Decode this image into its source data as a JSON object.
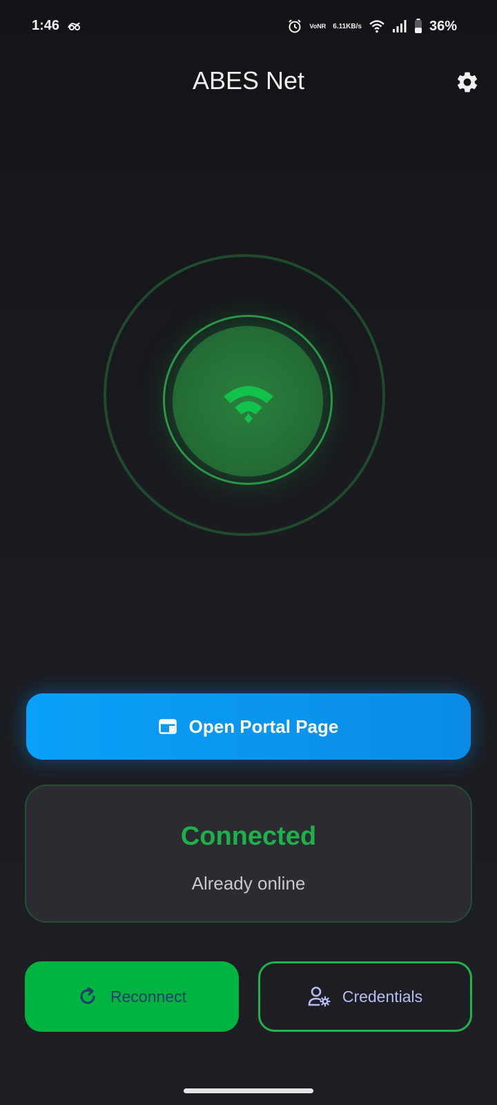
{
  "status_bar": {
    "time": "1:46",
    "volte_top": "Vo",
    "volte_bottom": "NR",
    "speed_value": "6.11",
    "speed_unit": "KB/s",
    "battery_percent": "36%",
    "icons": [
      "alarm-icon",
      "volte-icon",
      "wifi-icon",
      "signal-icon",
      "battery-icon"
    ]
  },
  "header": {
    "title": "ABES Net",
    "settings_icon": "gear-icon"
  },
  "connection_graphic": {
    "icon": "wifi-icon",
    "accent_color": "#20b04a"
  },
  "portal_button": {
    "label": "Open Portal Page",
    "icon": "web-page-icon",
    "color": "#0a97f0"
  },
  "status_card": {
    "title": "Connected",
    "subtitle": "Already online",
    "title_color": "#20b04a"
  },
  "actions": {
    "reconnect_label": "Reconnect",
    "reconnect_icon": "refresh-icon",
    "credentials_label": "Credentials",
    "credentials_icon": "user-settings-icon"
  }
}
